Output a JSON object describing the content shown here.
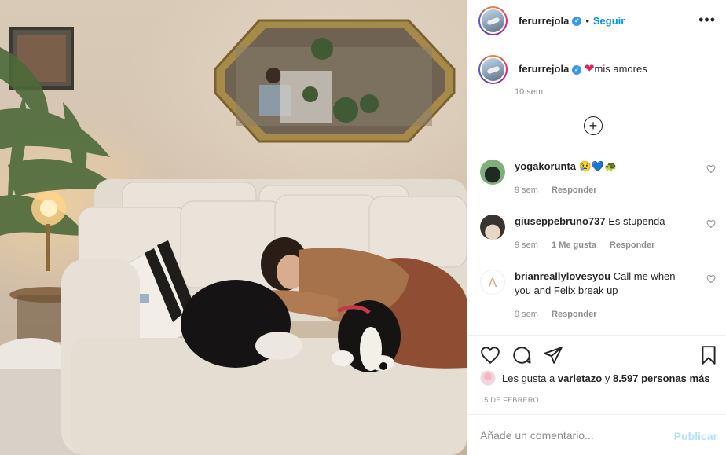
{
  "post": {
    "username": "ferurrejola",
    "follow_label": "Seguir",
    "separator": "•",
    "more_label": "•••",
    "caption_username": "ferurrejola",
    "caption_heart": "❤",
    "caption_text": "mis amores",
    "caption_time": "10 sem",
    "load_more_label": "+"
  },
  "comments": [
    {
      "username": "yogakorunta",
      "text": "😢💙🐢",
      "time": "9 sem",
      "likes": "",
      "reply": "Responder"
    },
    {
      "username": "giuseppebruno737",
      "text": "Es stupenda",
      "time": "9 sem",
      "likes": "1 Me gusta",
      "reply": "Responder"
    },
    {
      "username": "brianreallylovesyou",
      "text": "Call me when you and Felix break up",
      "time": "9 sem",
      "likes": "",
      "reply": "Responder"
    }
  ],
  "likes": {
    "prefix": "Les gusta a",
    "user": "varletazo",
    "joiner": "y",
    "count": "8.597 personas más"
  },
  "date": "15 DE FEBRERO",
  "composer": {
    "placeholder": "Añade un comentario...",
    "publish_label": "Publicar"
  },
  "colors": {
    "link_blue": "#0095f6",
    "publish_disabled": "#b2dffc",
    "verified_blue": "#3897f0",
    "muted_text": "#8e8e8e"
  },
  "icons": [
    "heart-icon",
    "comment-icon",
    "share-icon",
    "bookmark-icon",
    "plus-circle-icon",
    "more-options-icon",
    "verified-badge-icon"
  ]
}
